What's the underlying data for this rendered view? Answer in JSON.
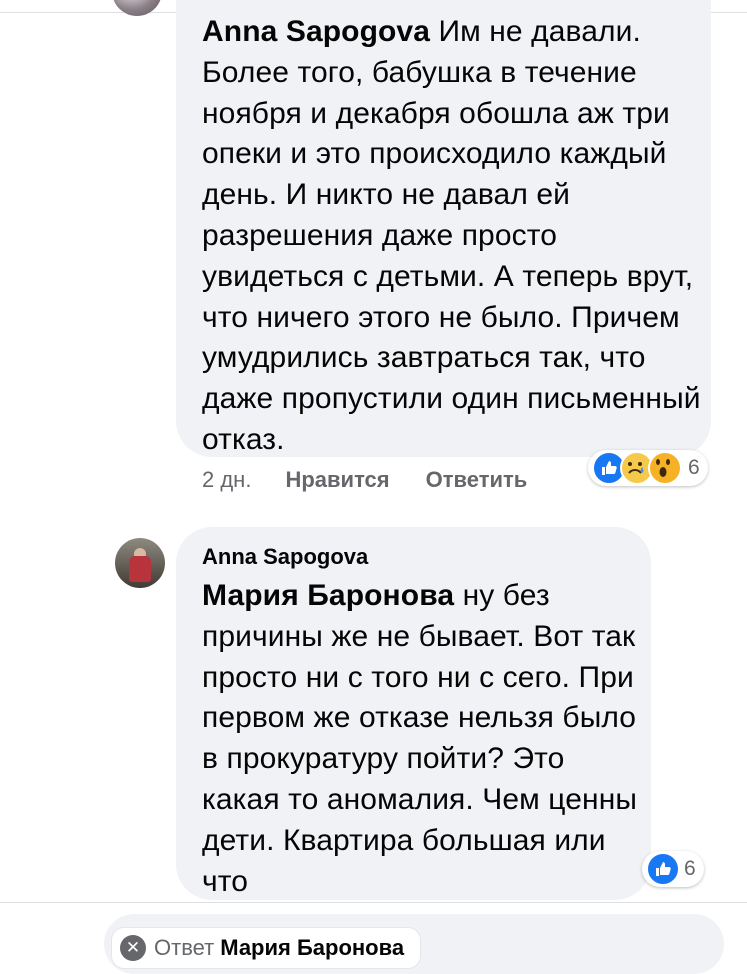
{
  "comment1": {
    "author": "Anna Sapogova",
    "text": "Им не давали. Более того, бабушка в течение ноября и декабря обошла аж три опеки и это происходило каждый день. И никто не давал ей разрешения даже просто увидеться с детьми. А теперь врут, что ничего этого не было. Причем умудрились завтраться так, что даже пропустили один письменный отказ.",
    "time": "2 дн.",
    "like_label": "Нравится",
    "reply_label": "Ответить",
    "reaction_icons": [
      "like-icon",
      "sad-icon",
      "wow-icon"
    ],
    "reaction_count": "6"
  },
  "comment2": {
    "author": "Anna Sapogova",
    "mention": "Мария Баронова",
    "text": "ну без причины же не бывает. Вот так просто ни с того ни с сего. При первом же отказе нельзя было в прокуратуру пойти? Это какая то аномалия. Чем ценны дети. Квартира большая или что",
    "reaction_icons": [
      "like-icon"
    ],
    "reaction_count": "6"
  },
  "reply_box": {
    "prefix": "Ответ",
    "target": "Мария Баронова",
    "close_icon": "close-icon"
  },
  "colors": {
    "bubble": "#f0f2f5",
    "meta_text": "#65676b",
    "like_blue": "#1877f2"
  }
}
